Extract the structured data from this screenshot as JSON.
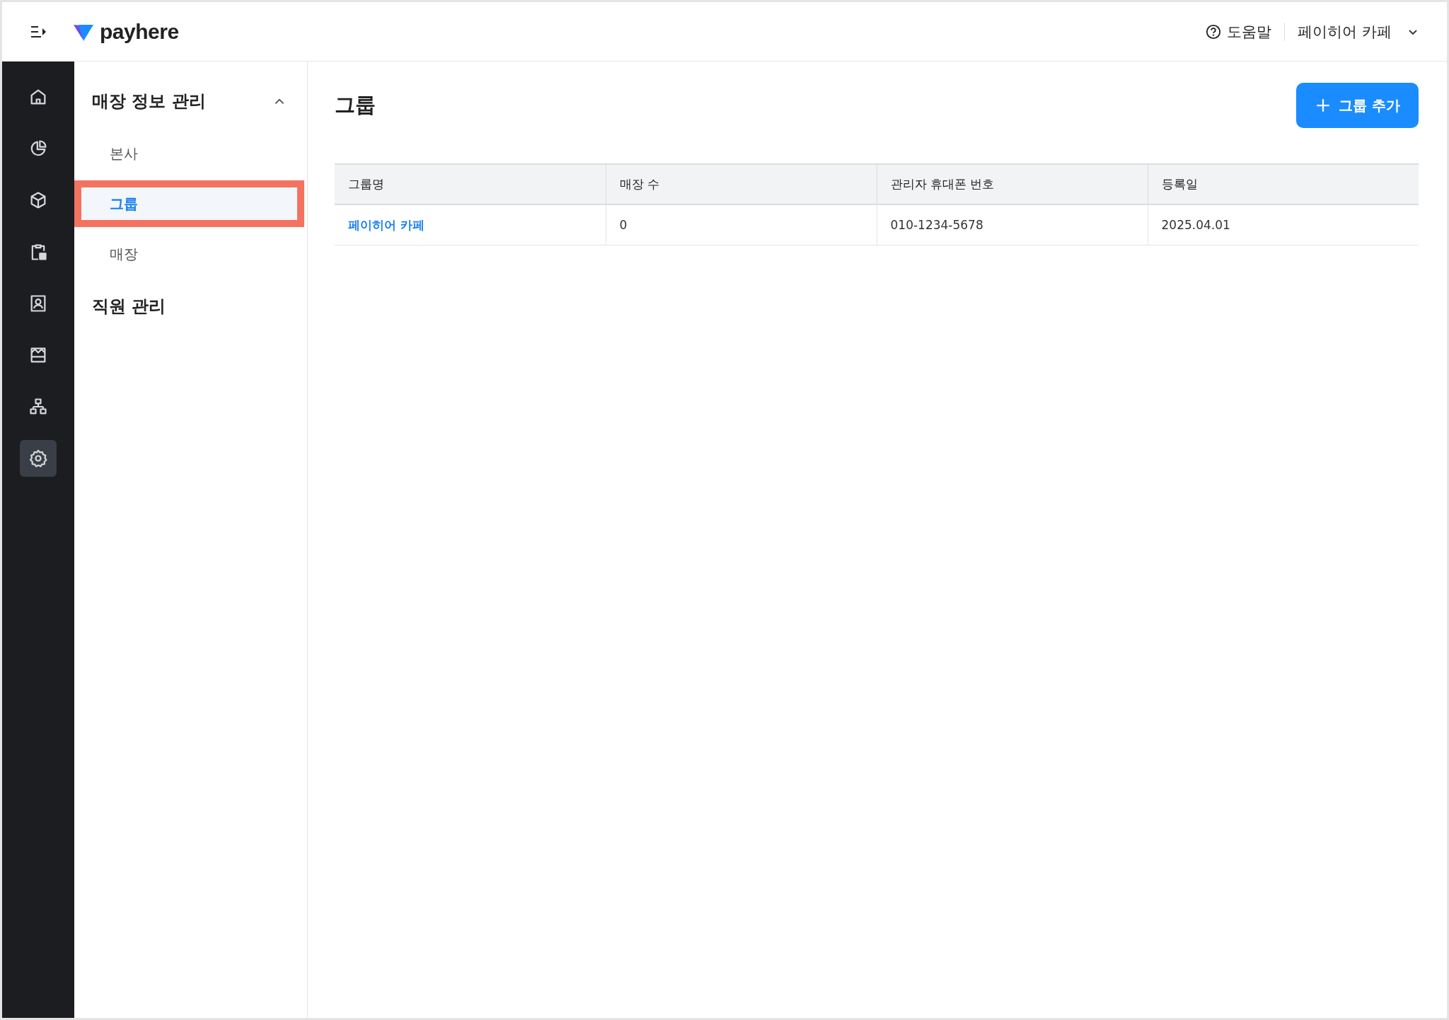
{
  "header": {
    "brand": "payhere",
    "help": "도움말",
    "account": "페이히어 카페"
  },
  "rail": [
    {
      "kind": "home",
      "selected": false
    },
    {
      "kind": "chart",
      "selected": false
    },
    {
      "kind": "box",
      "selected": false
    },
    {
      "kind": "clipboard",
      "selected": false
    },
    {
      "kind": "contact",
      "selected": false
    },
    {
      "kind": "store",
      "selected": false
    },
    {
      "kind": "org",
      "selected": false
    },
    {
      "kind": "settings",
      "selected": true
    }
  ],
  "submenu": [
    {
      "label": "매장 정보 관리",
      "expanded": true,
      "children": [
        {
          "label": "본사",
          "selected": false
        },
        {
          "label": "그룹",
          "selected": true
        },
        {
          "label": "매장",
          "selected": false
        }
      ]
    },
    {
      "label": "직원 관리"
    }
  ],
  "page": {
    "title": "그룹",
    "add_button": "그룹 추가"
  },
  "table": {
    "columns": [
      "그룹명",
      "매장 수",
      "관리자 휴대폰 번호",
      "등록일"
    ],
    "rows": [
      [
        "페이히어 카페",
        "0",
        "010-1234-5678",
        "2025.04.01"
      ]
    ]
  }
}
